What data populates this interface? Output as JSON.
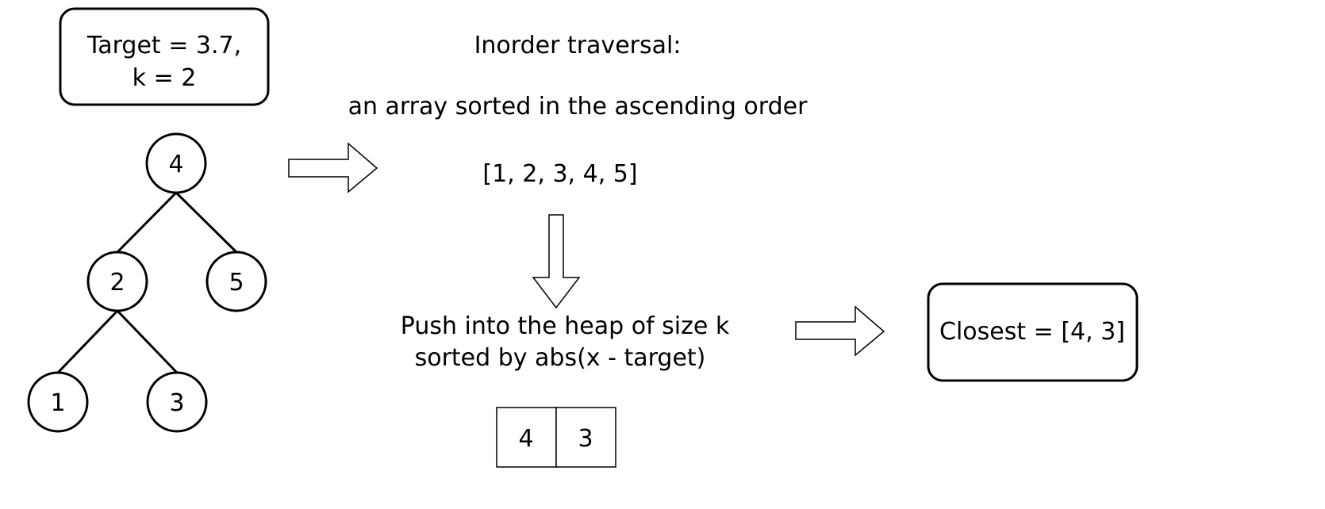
{
  "params": {
    "line1": "Target = 3.7,",
    "line2": "k = 2"
  },
  "tree": {
    "nodes": [
      {
        "id": "n4",
        "label": "4"
      },
      {
        "id": "n2",
        "label": "2"
      },
      {
        "id": "n5",
        "label": "5"
      },
      {
        "id": "n1",
        "label": "1"
      },
      {
        "id": "n3",
        "label": "3"
      }
    ],
    "edges": [
      [
        "n4",
        "n2"
      ],
      [
        "n4",
        "n5"
      ],
      [
        "n2",
        "n1"
      ],
      [
        "n2",
        "n3"
      ]
    ]
  },
  "step1": {
    "title": "Inorder traversal:",
    "subtitle": "an array sorted in the ascending order",
    "array": "[1, 2, 3, 4, 5]"
  },
  "step2": {
    "line1": "Push into the heap of size k",
    "line2": "sorted by abs(x - target)",
    "heap": [
      "4",
      "3"
    ]
  },
  "result": {
    "label": "Closest = [4, 3]"
  }
}
